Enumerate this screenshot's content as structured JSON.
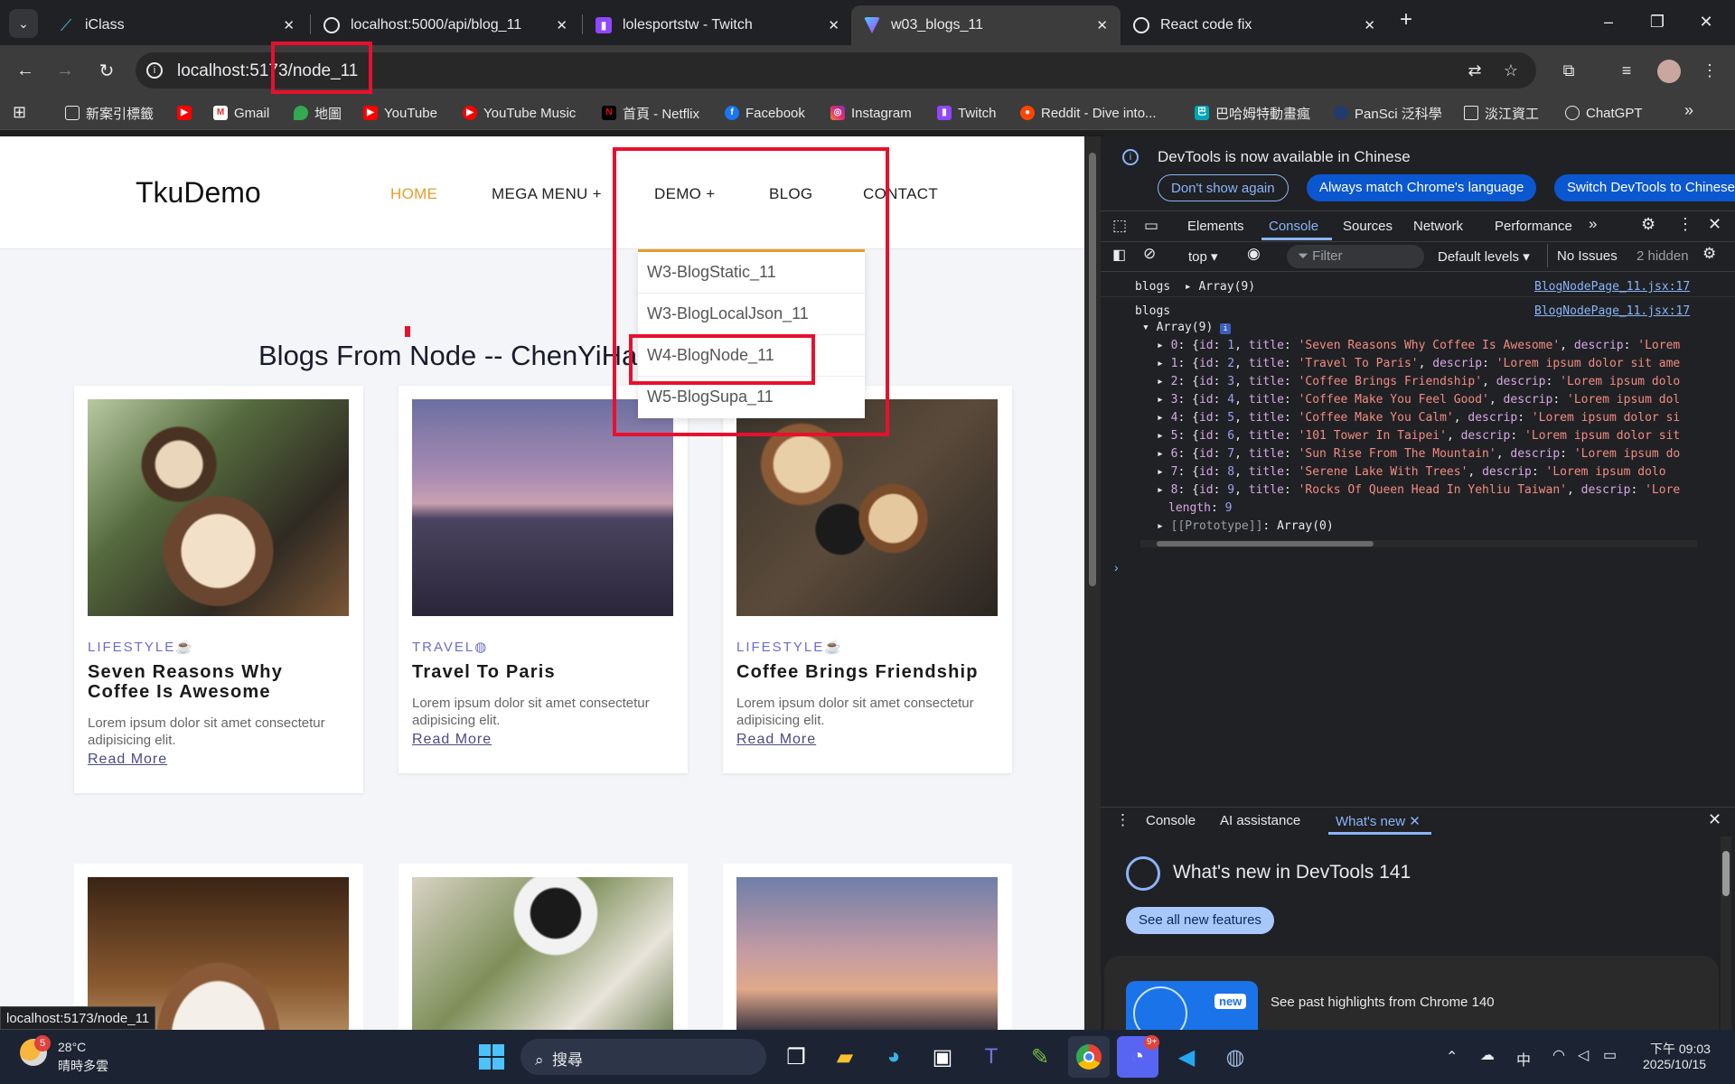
{
  "browser": {
    "tabs": [
      {
        "title": "iClass",
        "icon": "iclass-icon"
      },
      {
        "title": "localhost:5000/api/blog_11",
        "icon": "globe-icon"
      },
      {
        "title": "lolesportstw - Twitch",
        "icon": "twitch-icon"
      },
      {
        "title": "w03_blogs_11",
        "icon": "vite-icon"
      },
      {
        "title": "React code fix",
        "icon": "chatgpt-icon"
      }
    ],
    "url": "localhost:5173/node_11",
    "status_url": "localhost:5173/node_11",
    "bookmarks": [
      "新案引標籤",
      "Gmail",
      "地圖",
      "YouTube",
      "YouTube Music",
      "首頁 - Netflix",
      "Facebook",
      "Instagram",
      "Twitch",
      "Reddit - Dive into...",
      "巴哈姆特動畫瘋",
      "PanSci 泛科學",
      "淡江資工",
      "ChatGPT"
    ]
  },
  "site": {
    "brand": "TkuDemo",
    "nav": [
      "HOME",
      "MEGA MENU +",
      "DEMO +",
      "BLOG",
      "CONTACT"
    ],
    "dropdown": [
      "W3-BlogStatic_11",
      "W3-BlogLocalJson_11",
      "W4-BlogNode_11",
      "W5-BlogSupa_11"
    ],
    "heading": "Blogs From Node -- ChenYiHa",
    "cards": [
      {
        "category": "LIFESTYLE",
        "title": "Seven Reasons Why Coffee Is Awesome",
        "desc": "Lorem ipsum dolor sit amet consectetur adipisicing elit.",
        "link": "Read More"
      },
      {
        "category": "TRAVEL",
        "title": "Travel To Paris",
        "desc": "Lorem ipsum dolor sit amet consectetur adipisicing elit.",
        "link": "Read More"
      },
      {
        "category": "LIFESTYLE",
        "title": "Coffee Brings Friendship",
        "desc": "Lorem ipsum dolor sit amet consectetur adipisicing elit.",
        "link": "Read More"
      }
    ]
  },
  "devtools": {
    "banner": "DevTools is now available in Chinese",
    "banner_buttons": [
      "Don't show again",
      "Always match Chrome's language",
      "Switch DevTools to Chinese"
    ],
    "tabs": [
      "Elements",
      "Console",
      "Sources",
      "Network",
      "Performance"
    ],
    "toolbar": {
      "context": "top",
      "filter": "Filter",
      "levels": "Default levels",
      "issues": "No Issues",
      "hidden": "2 hidden"
    },
    "log1_label": "blogs",
    "log1_value": "Array(9)",
    "source": "BlogNodePage_11.jsx:17",
    "log2_label": "blogs",
    "log2_value": "Array(9)",
    "entries": [
      {
        "i": "0",
        "id": "1",
        "title": "'Seven Reasons Why Coffee Is Awesome'",
        "descrip": "'Lorem"
      },
      {
        "i": "1",
        "id": "2",
        "title": "'Travel To Paris'",
        "descrip": "'Lorem ipsum dolor sit ame"
      },
      {
        "i": "2",
        "id": "3",
        "title": "'Coffee Brings Friendship'",
        "descrip": "'Lorem ipsum dolo"
      },
      {
        "i": "3",
        "id": "4",
        "title": "'Coffee Make You Feel Good'",
        "descrip": "'Lorem ipsum dol"
      },
      {
        "i": "4",
        "id": "5",
        "title": "'Coffee Make You Calm'",
        "descrip": "'Lorem ipsum dolor si"
      },
      {
        "i": "5",
        "id": "6",
        "title": "'101 Tower In Taipei'",
        "descrip": "'Lorem ipsum dolor sit"
      },
      {
        "i": "6",
        "id": "7",
        "title": "'Sun Rise From The Mountain'",
        "descrip": "'Lorem ipsum do"
      },
      {
        "i": "7",
        "id": "8",
        "title": "'Serene Lake With Trees'",
        "descrip": "'Lorem ipsum dolo"
      },
      {
        "i": "8",
        "id": "9",
        "title": "'Rocks Of Queen Head In Yehliu Taiwan'",
        "descrip": "'Lore"
      }
    ],
    "length_label": "length",
    "length_value": "9",
    "prototype_label": "[[Prototype]]",
    "prototype_value": "Array(0)",
    "drawer_tabs": [
      "Console",
      "AI assistance",
      "What's new"
    ],
    "whatsnew_title": "What's new in DevTools 141",
    "see_all": "See all new features",
    "new_badge": "new",
    "highlights": "See past highlights from Chrome 140"
  },
  "taskbar": {
    "weather_temp": "28°C",
    "weather_desc": "晴時多雲",
    "weather_badge": "5",
    "search": "搜尋",
    "ime": "中",
    "time": "下午 09:03",
    "date": "2025/10/15",
    "discord_badge": "9+"
  }
}
